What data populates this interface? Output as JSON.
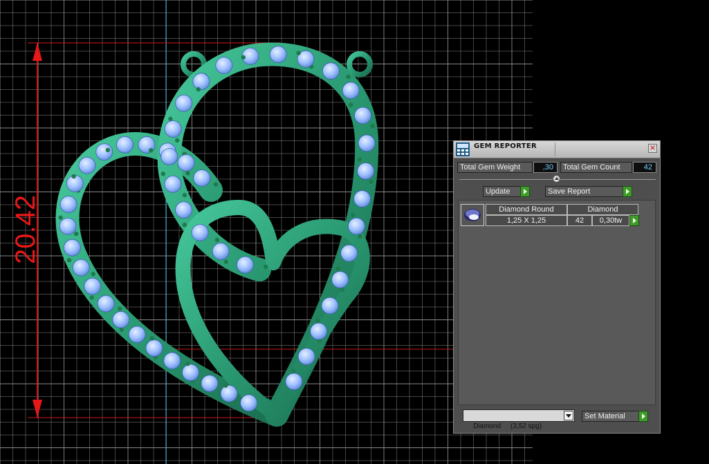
{
  "viewport": {
    "dimension_label": "20.42",
    "dimension_color": "#e81818",
    "grid_color": "#8a8a8a",
    "model_color": "#2fa07a",
    "gem_color": "#9fc4ff",
    "prong_color": "#1f7a4d"
  },
  "gem_reporter": {
    "title": "GEM REPORTER",
    "close_icon": "close-icon",
    "total_gem_weight_label": "Total Gem Weight",
    "total_gem_weight_value": ",30",
    "total_gem_count_label": "Total Gem Count",
    "total_gem_count_value": "42",
    "update_label": "Update",
    "save_report_label": "Save Report",
    "gems": [
      {
        "icon": "round-gem-icon",
        "shape": "Diamond Round",
        "material": "Diamond",
        "size": "1,25 X 1,25",
        "count": "42",
        "weight": "0,30tw"
      }
    ],
    "material_select_value": "Diamond     (3,52 spg)",
    "set_material_label": "Set Material",
    "accent_green": "#3f9a2a"
  }
}
